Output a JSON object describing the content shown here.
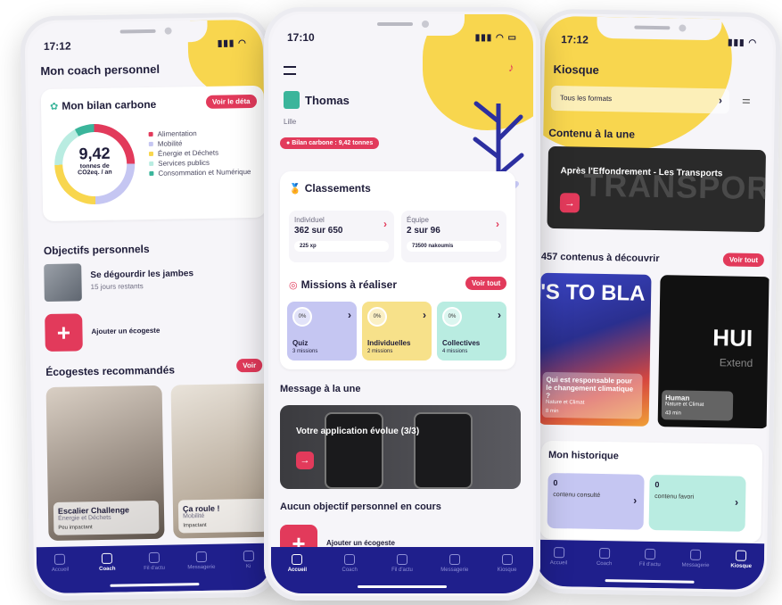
{
  "colors": {
    "accent": "#e23a5b",
    "navy": "#1f1f8c",
    "yellow": "#f8d64e",
    "purple": "#c5c6f2",
    "gold": "#f7e18a",
    "mint": "#b9ece1"
  },
  "left": {
    "time": "17:12",
    "title": "Mon coach personnel",
    "bilan": {
      "title": "Mon bilan carbone",
      "btn": "Voir le déta",
      "value": "9,42",
      "unit_line1": "tonnes de",
      "unit_line2": "CO2eq. / an",
      "legend": [
        {
          "label": "Alimentation",
          "color": "#e23a5b"
        },
        {
          "label": "Mobilité",
          "color": "#c5c6f2"
        },
        {
          "label": "Énergie et Déchets",
          "color": "#f8d64e"
        },
        {
          "label": "Services publics",
          "color": "#b9ece1"
        },
        {
          "label": "Consommation et Numérique",
          "color": "#3bb59b"
        }
      ]
    },
    "objectifs": {
      "title": "Objectifs personnels",
      "item_title": "Se dégourdir les jambes",
      "item_sub": "15 jours restants",
      "add": "Ajouter un écogeste"
    },
    "reco": {
      "title": "Écogestes recommandés",
      "btn": "Voir",
      "cards": [
        {
          "title": "Escalier Challenge",
          "sub": "Énergie et Déchets",
          "tag": "Peu impactant"
        },
        {
          "title": "Ça roule !",
          "sub": "Mobilité",
          "tag": "Impactant"
        }
      ]
    },
    "nav": [
      {
        "label": "Accueil",
        "active": false
      },
      {
        "label": "Coach",
        "active": true
      },
      {
        "label": "Fil d'actu",
        "active": false
      },
      {
        "label": "Messagerie",
        "active": false
      },
      {
        "label": "Ki",
        "active": false
      }
    ]
  },
  "middle": {
    "time": "17:10",
    "user": {
      "name": "Thomas",
      "city": "Lille",
      "badge": "Bilan carbone : 9,42 tonnes"
    },
    "classements": {
      "title": "Classements",
      "individuel": {
        "label": "Individuel",
        "rank": "362 sur 650",
        "xp": "225 xp"
      },
      "equipe": {
        "label": "Équipe",
        "rank": "2 sur 96",
        "xp": "73500 nakoumis"
      }
    },
    "missions": {
      "title": "Missions à réaliser",
      "btn": "Voir tout",
      "items": [
        {
          "title": "Quiz",
          "sub": "3 missions",
          "pct": "0%",
          "color": "#c5c6f2"
        },
        {
          "title": "Individuelles",
          "sub": "2 missions",
          "pct": "0%",
          "color": "#f7e18a"
        },
        {
          "title": "Collectives",
          "sub": "4 missions",
          "pct": "0%",
          "color": "#b9ece1"
        }
      ]
    },
    "message": {
      "title": "Message à la une",
      "text": "Votre application évolue (3/3)"
    },
    "aucun": {
      "title": "Aucun objectif personnel en cours",
      "add": "Ajouter un écogeste"
    },
    "nav": [
      {
        "label": "Accueil",
        "active": true
      },
      {
        "label": "Coach",
        "active": false
      },
      {
        "label": "Fil d'actu",
        "active": false
      },
      {
        "label": "Messagerie",
        "active": false
      },
      {
        "label": "Kiosque",
        "active": false
      }
    ]
  },
  "right": {
    "time": "17:12",
    "title": "Kiosque",
    "filter": "Tous les formats",
    "une": {
      "title": "Contenu à la une",
      "card": "Après l'Effondrement - Les Transports",
      "bg_text": "TRANSPORTS"
    },
    "contenus": {
      "title": "457 contenus à découvrir",
      "btn": "Voir tout",
      "cards": [
        {
          "big": "'S TO BLA",
          "title": "Qui est responsable pour le changement climatique ?",
          "sub": "Nature et Climat",
          "time": "8 min"
        },
        {
          "big": "HUI",
          "sub2": "Extend",
          "title": "Human",
          "sub": "Nature et Climat",
          "time": "43 min"
        }
      ]
    },
    "historique": {
      "title": "Mon historique",
      "items": [
        {
          "count": "0",
          "label": "contenu consulté"
        },
        {
          "count": "0",
          "label": "contenu favori"
        }
      ]
    },
    "nav": [
      {
        "label": "Accueil",
        "active": false
      },
      {
        "label": "Coach",
        "active": false
      },
      {
        "label": "Fil d'actu",
        "active": false
      },
      {
        "label": "Messagerie",
        "active": false
      },
      {
        "label": "Kiosque",
        "active": true
      }
    ]
  }
}
